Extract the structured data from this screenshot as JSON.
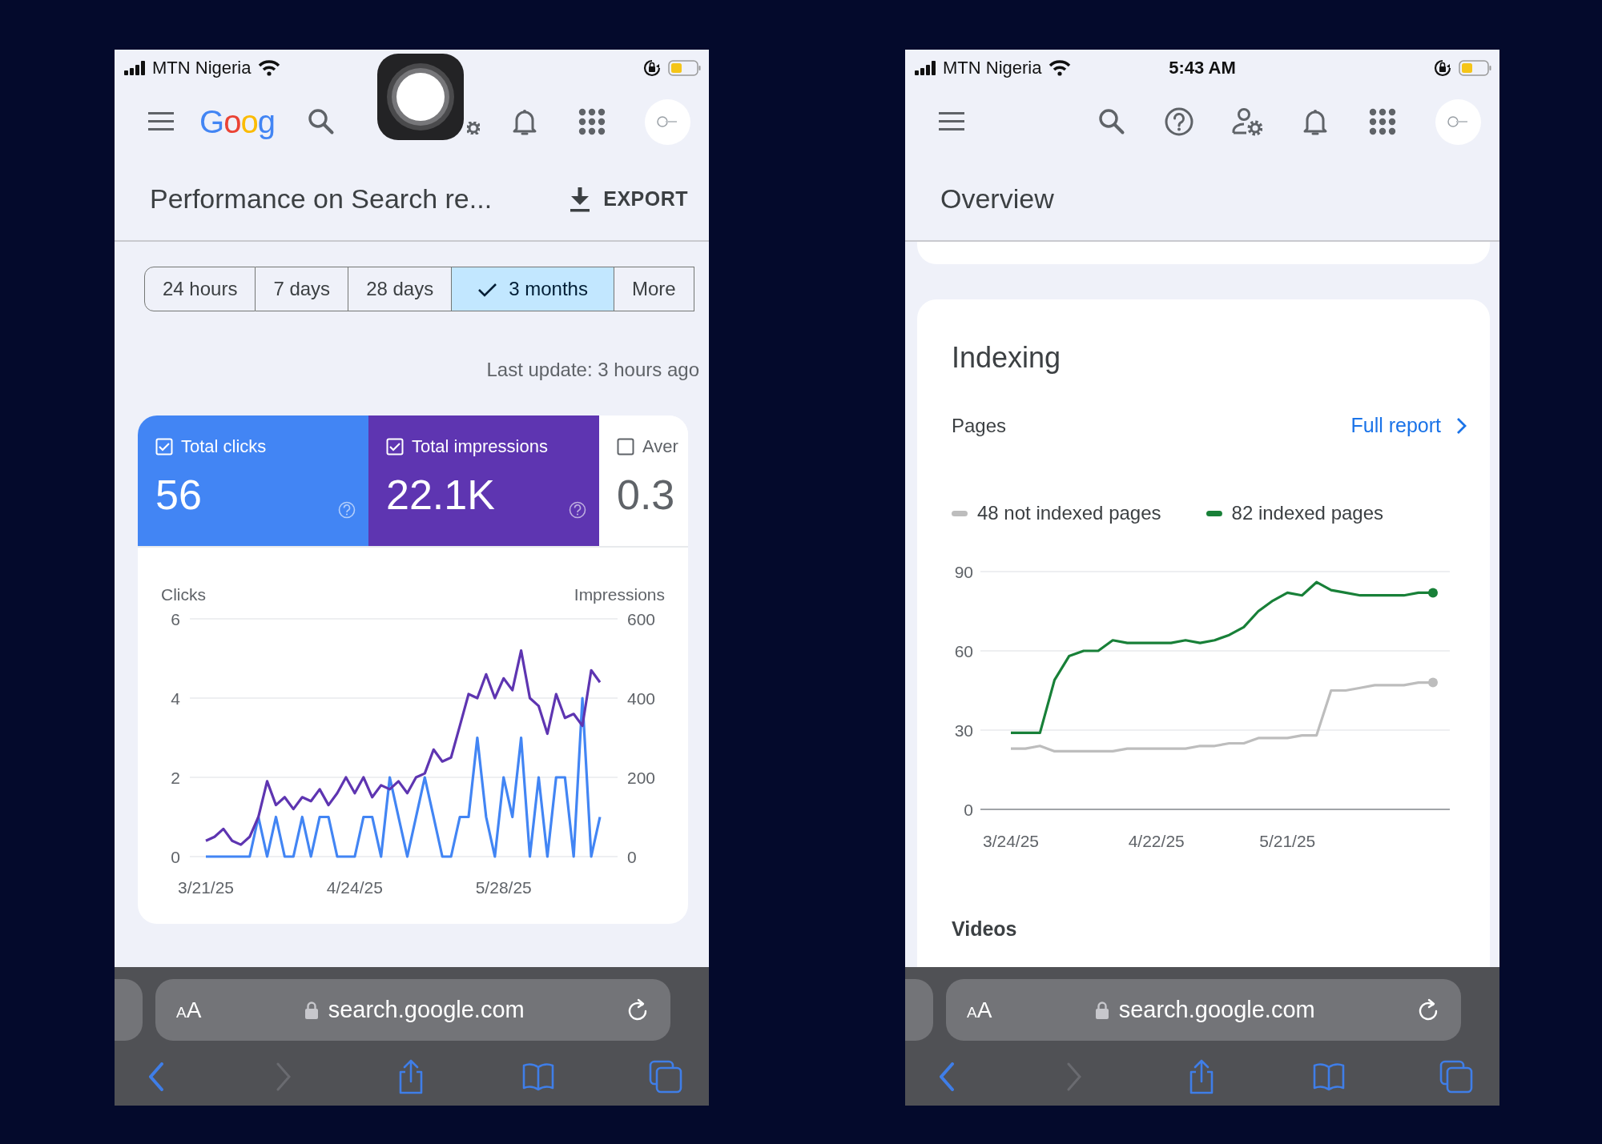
{
  "phones": [
    {
      "status_bar": {
        "carrier": "MTN Nigeria"
      },
      "header": {
        "logo": "Goog",
        "assistive_touch_overlay": true
      },
      "title": "Performance on Search re...",
      "export_button": "EXPORT",
      "date_ranges": [
        {
          "label": "24 hours",
          "selected": false
        },
        {
          "label": "7 days",
          "selected": false
        },
        {
          "label": "28 days",
          "selected": false
        },
        {
          "label": "3 months",
          "selected": true
        },
        {
          "label": "More",
          "selected": false
        }
      ],
      "last_update": "Last update: 3 hours ago",
      "metrics": [
        {
          "label": "Total clicks",
          "value": "56",
          "checked": true,
          "color": "#4285f4",
          "help_icon": true
        },
        {
          "label": "Total impressions",
          "value": "22.1K",
          "checked": true,
          "color": "#5e35b1",
          "help_icon": true
        },
        {
          "label": "Aver",
          "value": "0.3",
          "checked": false,
          "help_icon": false
        }
      ],
      "clicks_chart": {
        "chart_data": {
          "type": "line",
          "categories": [
            "3/21/25",
            null,
            null,
            null,
            null,
            null,
            null,
            null,
            null,
            null,
            null,
            null,
            null,
            null,
            null,
            null,
            null,
            "4/24/25",
            null,
            null,
            null,
            null,
            null,
            null,
            null,
            null,
            null,
            null,
            null,
            null,
            null,
            null,
            null,
            null,
            "5/28/25",
            null,
            null,
            null,
            null,
            null,
            null,
            null,
            null,
            null,
            null,
            null
          ],
          "ylim": [
            0,
            6
          ],
          "yticks": [
            0,
            2,
            4,
            6
          ],
          "series": [
            {
              "name": "Clicks",
              "color": "#4285f4",
              "values": [
                0,
                0,
                0,
                0,
                0,
                0,
                1,
                0,
                1,
                0,
                0,
                1,
                0,
                1,
                1,
                0,
                0,
                0,
                1,
                1,
                0,
                2,
                1,
                0,
                1,
                2,
                1,
                0,
                0,
                1,
                1,
                3,
                1,
                0,
                2,
                1,
                3,
                0,
                2,
                0,
                2,
                2,
                0,
                4,
                0,
                1
              ]
            }
          ]
        }
      },
      "impressions_chart": {
        "chart_data": {
          "type": "line",
          "categories": [
            null,
            null,
            null,
            null,
            null,
            null,
            null,
            null,
            null,
            null,
            null,
            null,
            null,
            null,
            null,
            null,
            null,
            null,
            null,
            null,
            null,
            null,
            null,
            null,
            null,
            null,
            null,
            null,
            null,
            null,
            null,
            null,
            null,
            null,
            null,
            null,
            null,
            null,
            null,
            null,
            null,
            null,
            null,
            null,
            null,
            null
          ],
          "ylim": [
            0,
            600
          ],
          "yticks": [
            0,
            200,
            400,
            600
          ],
          "series": [
            {
              "name": "Impressions",
              "color": "#5e35b1",
              "values": [
                40,
                50,
                70,
                40,
                30,
                50,
                100,
                190,
                130,
                150,
                120,
                150,
                140,
                170,
                130,
                160,
                200,
                160,
                200,
                150,
                180,
                170,
                190,
                160,
                200,
                210,
                270,
                240,
                250,
                330,
                410,
                400,
                460,
                400,
                450,
                420,
                520,
                400,
                380,
                310,
                410,
                350,
                360,
                330,
                470,
                440
              ]
            }
          ]
        }
      },
      "browser": {
        "text_size_button": "AA",
        "url": "search.google.com"
      }
    },
    {
      "status_bar": {
        "carrier": "MTN Nigeria",
        "time": "5:43 AM"
      },
      "header": {
        "assistive_touch_overlay": false
      },
      "title": "Overview",
      "indexing": {
        "title": "Indexing",
        "subtitle": "Pages",
        "link": "Full report",
        "chart_data": {
          "type": "line",
          "categories": [
            "3/24/25",
            null,
            null,
            null,
            null,
            null,
            null,
            null,
            null,
            null,
            "4/22/25",
            null,
            null,
            null,
            null,
            null,
            null,
            null,
            null,
            "5/21/25",
            null,
            null,
            null,
            null,
            null,
            null,
            null,
            null,
            null,
            null
          ],
          "ylim": [
            0,
            90
          ],
          "yticks": [
            0,
            30,
            60,
            90
          ],
          "series": [
            {
              "name": "48 not indexed pages",
              "color": "#bdbdbd",
              "values": [
                23,
                23,
                24,
                22,
                22,
                22,
                22,
                22,
                23,
                23,
                23,
                23,
                23,
                24,
                24,
                25,
                25,
                27,
                27,
                27,
                28,
                28,
                45,
                45,
                46,
                47,
                47,
                47,
                48,
                48
              ]
            },
            {
              "name": "82 indexed pages",
              "color": "#188038",
              "values": [
                29,
                29,
                29,
                49,
                58,
                60,
                60,
                64,
                63,
                63,
                63,
                63,
                64,
                63,
                64,
                66,
                69,
                75,
                79,
                82,
                81,
                86,
                83,
                82,
                81,
                81,
                81,
                81,
                82,
                82
              ]
            }
          ]
        },
        "next_section": "Videos"
      },
      "browser": {
        "text_size_button": "AA",
        "url": "search.google.com"
      }
    }
  ]
}
